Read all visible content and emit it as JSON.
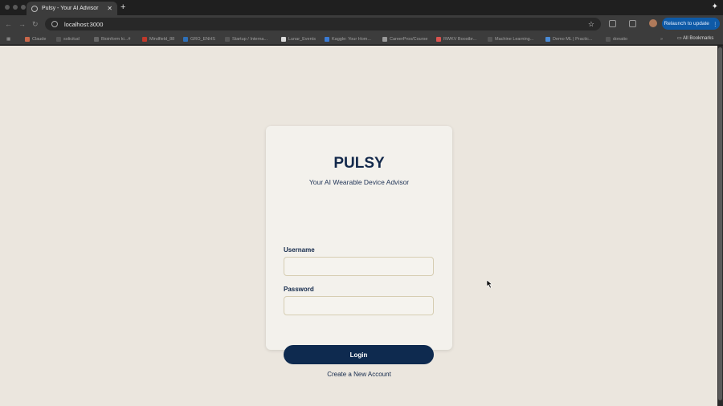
{
  "browser": {
    "tab": {
      "title": "Pulsy - Your AI Advisor"
    },
    "address": {
      "url": "localhost:3000"
    },
    "relaunch_label": "Relaunch to update",
    "bookmarks": [
      "Claude",
      "solicitud",
      "Bioinform ki...#",
      "Mindfield_88",
      "GRO_ENHS",
      "Startup / Interna...",
      "Lunar_Events",
      "Kaggle: Your Hom...",
      "CareerPros/Course",
      "RWKV Boostbr...",
      "Machine Learning...",
      "Demo ML | Practic...",
      "donatio"
    ],
    "all_bookmarks_label": "All Bookmarks"
  },
  "login": {
    "brand": "PULSY",
    "tagline": "Your AI Wearable Device Advisor",
    "username_label": "Username",
    "username_value": "",
    "password_label": "Password",
    "password_value": "",
    "login_button": "Login",
    "create_account_link": "Create a New Account"
  },
  "colors": {
    "page_background": "#ebe6de",
    "card_background": "#f3f1ec",
    "brand_navy": "#13294b",
    "button_navy": "#0e2a4f",
    "field_border": "#d6cdb2",
    "relaunch_blue": "#0e5aa7"
  }
}
